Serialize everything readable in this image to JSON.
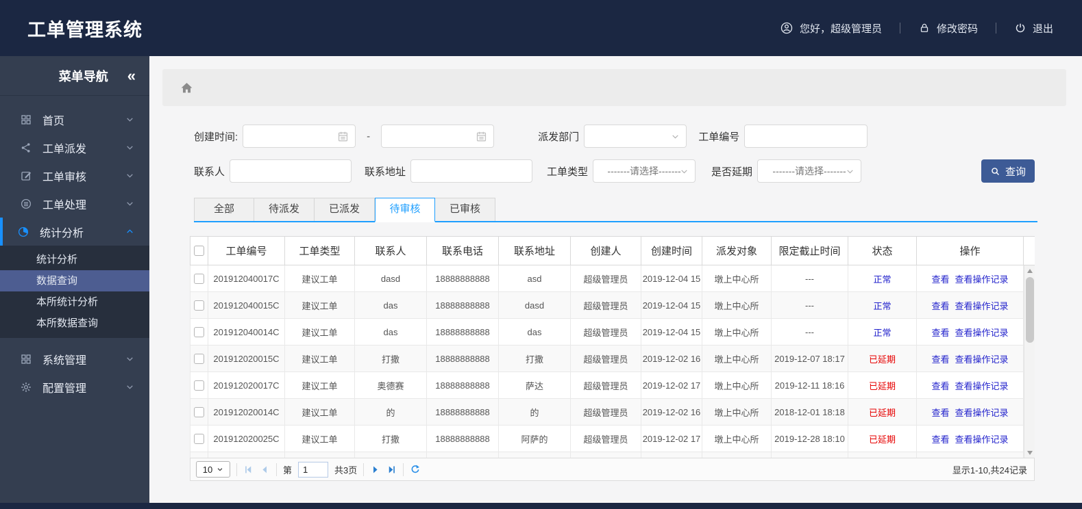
{
  "colors": {
    "header_bg": "#1b2742",
    "sidebar_bg": "#343e50",
    "accent_blue": "#1890ff",
    "tab_active_blue": "#1e9fff",
    "search_button_bg": "#3d5b96",
    "link_blue": "#2323cc",
    "status_normal_blue": "#2323cc",
    "status_delayed_red": "#e60000",
    "submenu_selected_bg": "#4d5d91"
  },
  "header": {
    "title": "工单管理系统",
    "greeting": "您好，超级管理员",
    "change_password": "修改密码",
    "logout": "退出"
  },
  "sidebar": {
    "title": "菜单导航",
    "collapse_glyph": "«",
    "items": [
      {
        "label": "首页",
        "icon": "grid-icon"
      },
      {
        "label": "工单派发",
        "icon": "share-icon"
      },
      {
        "label": "工单审核",
        "icon": "edit-icon"
      },
      {
        "label": "工单处理",
        "icon": "process-icon"
      },
      {
        "label": "统计分析",
        "icon": "pie-chart-icon",
        "active": true,
        "expanded": true
      },
      {
        "label": "系统管理",
        "icon": "grid-icon"
      },
      {
        "label": "配置管理",
        "icon": "gear-icon"
      }
    ],
    "submenu": [
      {
        "label": "统计分析",
        "selected": false
      },
      {
        "label": "数据查询",
        "selected": true
      },
      {
        "label": "本所统计分析",
        "selected": false
      },
      {
        "label": "本所数据查询",
        "selected": false
      }
    ]
  },
  "filters": {
    "created_time_label": "创建时间:",
    "date_separator": "-",
    "start_date_value": "",
    "end_date_value": "",
    "dispatch_dept_label": "派发部门",
    "dispatch_dept_value": "",
    "order_no_label": "工单编号",
    "order_no_value": "",
    "contact_label": "联系人",
    "contact_value": "",
    "address_label": "联系地址",
    "address_value": "",
    "order_type_label": "工单类型",
    "order_type_value": "-------请选择-------",
    "delay_label": "是否延期",
    "delay_value": "-------请选择-------",
    "search_button": "查询"
  },
  "tabs": [
    {
      "label": "全部",
      "active": false
    },
    {
      "label": "待派发",
      "active": false
    },
    {
      "label": "已派发",
      "active": false
    },
    {
      "label": "待审核",
      "active": true
    },
    {
      "label": "已审核",
      "active": false
    }
  ],
  "table": {
    "columns": [
      "工单编号",
      "工单类型",
      "联系人",
      "联系电话",
      "联系地址",
      "创建人",
      "创建时间",
      "派发对象",
      "限定截止时间",
      "状态",
      "操作"
    ],
    "action_view": "查看",
    "action_log": "查看操作记录",
    "rows": [
      {
        "order_no": "201912040017C",
        "order_type": "建议工单",
        "contact": "dasd",
        "phone": "18888888888",
        "address": "asd",
        "creator": "超级管理员",
        "created": "2019-12-04 15",
        "dispatch_target": "墩上中心所",
        "deadline": "---",
        "status": "正常"
      },
      {
        "order_no": "201912040015C",
        "order_type": "建议工单",
        "contact": "das",
        "phone": "18888888888",
        "address": "dasd",
        "creator": "超级管理员",
        "created": "2019-12-04 15",
        "dispatch_target": "墩上中心所",
        "deadline": "---",
        "status": "正常"
      },
      {
        "order_no": "201912040014C",
        "order_type": "建议工单",
        "contact": "das",
        "phone": "18888888888",
        "address": "das",
        "creator": "超级管理员",
        "created": "2019-12-04 15",
        "dispatch_target": "墩上中心所",
        "deadline": "---",
        "status": "正常"
      },
      {
        "order_no": "201912020015C",
        "order_type": "建议工单",
        "contact": "打撒",
        "phone": "18888888888",
        "address": "打撒",
        "creator": "超级管理员",
        "created": "2019-12-02 16",
        "dispatch_target": "墩上中心所",
        "deadline": "2019-12-07 18:17",
        "status": "已延期"
      },
      {
        "order_no": "201912020017C",
        "order_type": "建议工单",
        "contact": "奥德赛",
        "phone": "18888888888",
        "address": "萨达",
        "creator": "超级管理员",
        "created": "2019-12-02 17",
        "dispatch_target": "墩上中心所",
        "deadline": "2019-12-11 18:16",
        "status": "已延期"
      },
      {
        "order_no": "201912020014C",
        "order_type": "建议工单",
        "contact": "的",
        "phone": "18888888888",
        "address": "的",
        "creator": "超级管理员",
        "created": "2019-12-02 16",
        "dispatch_target": "墩上中心所",
        "deadline": "2018-12-01 18:18",
        "status": "已延期"
      },
      {
        "order_no": "201912020025C",
        "order_type": "建议工单",
        "contact": "打撒",
        "phone": "18888888888",
        "address": "阿萨的",
        "creator": "超级管理员",
        "created": "2019-12-02 17",
        "dispatch_target": "墩上中心所",
        "deadline": "2019-12-28 18:10",
        "status": "已延期"
      }
    ]
  },
  "pagination": {
    "page_size": "10",
    "page_prefix": "第",
    "current_page": "1",
    "total_pages": "共3页",
    "summary": "显示1-10,共24记录"
  }
}
